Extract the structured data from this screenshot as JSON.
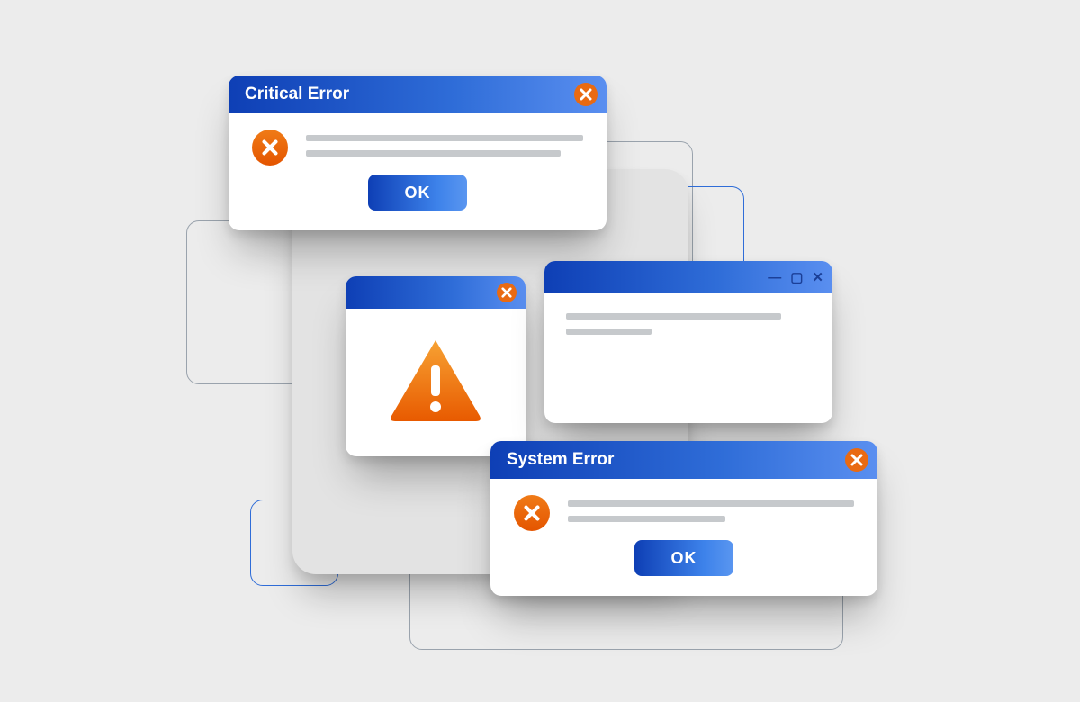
{
  "colors": {
    "accent_blue": "#2f6dd8",
    "accent_orange": "#e96a12",
    "bg": "#ececec"
  },
  "dialogs": {
    "critical": {
      "title": "Critical Error",
      "ok_label": "OK"
    },
    "system": {
      "title": "System Error",
      "ok_label": "OK"
    },
    "warning": {
      "title": ""
    },
    "plain": {
      "title": ""
    }
  },
  "icons": {
    "close": "close-icon",
    "error_x": "error-x-icon",
    "warning_triangle": "warning-triangle-icon",
    "minimize": "minimize-icon",
    "maximize": "maximize-icon"
  }
}
